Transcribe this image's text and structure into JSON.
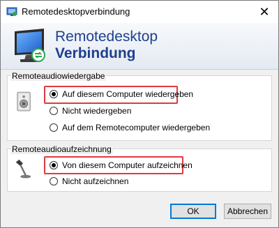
{
  "window": {
    "title": "Remotedesktopverbindung",
    "close_glyph": "✕",
    "app_icon": "remote-desktop-icon"
  },
  "banner": {
    "line1": "Remotedesktop",
    "line2": "Verbindung",
    "logo_icon": "remote-desktop-monitor-icon"
  },
  "playback": {
    "label": "Remoteaudiowiedergabe",
    "icon": "speaker-icon",
    "options": [
      {
        "label": "Auf diesem Computer wiedergeben",
        "checked": true
      },
      {
        "label": "Nicht wiedergeben",
        "checked": false
      },
      {
        "label": "Auf dem Remotecomputer wiedergeben",
        "checked": false
      }
    ]
  },
  "recording": {
    "label": "Remoteaudioaufzeichnung",
    "icon": "microphone-icon",
    "options": [
      {
        "label": "Von diesem Computer aufzeichnen",
        "checked": true
      },
      {
        "label": "Nicht aufzeichnen",
        "checked": false
      }
    ]
  },
  "buttons": {
    "ok": "OK",
    "cancel": "Abbrechen"
  },
  "colors": {
    "highlight": "#e0393e",
    "banner_text": "#1e3f8f"
  }
}
